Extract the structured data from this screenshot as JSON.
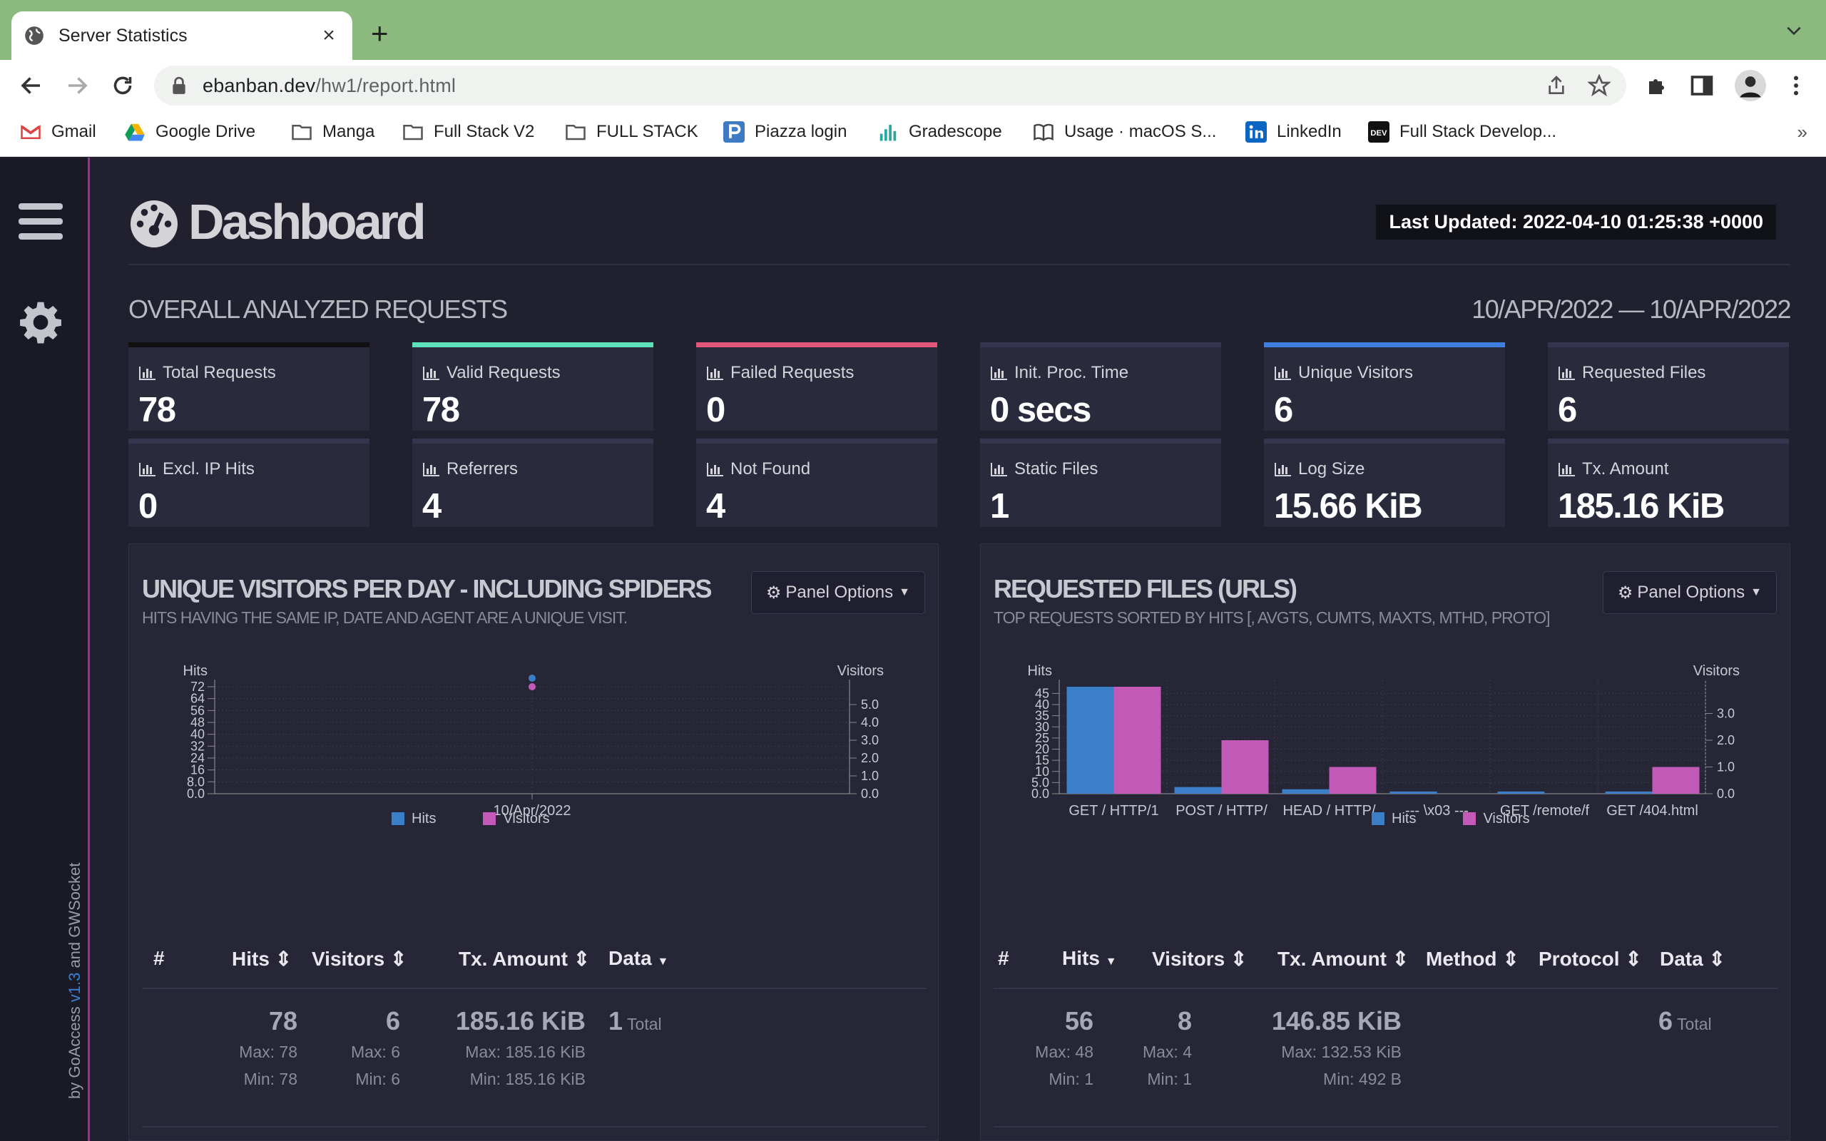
{
  "browser": {
    "tab_title": "Server Statistics",
    "url_domain": "ebanban.dev",
    "url_path": "/hw1/report.html",
    "bookmarks": [
      "Gmail",
      "Google Drive",
      "Manga",
      "Full Stack V2",
      "FULL STACK",
      "Piazza login",
      "Gradescope",
      "Usage · macOS S...",
      "LinkedIn",
      "Full Stack Develop..."
    ],
    "bookmarks_more": "»"
  },
  "sidebar": {
    "credit_by": "by ",
    "credit_goaccess": "GoAccess ",
    "credit_version": "v1.3",
    "credit_and": " and GWSocket"
  },
  "header": {
    "title": "Dashboard",
    "last_updated": "Last Updated: 2022-04-10 01:25:38 +0000"
  },
  "overview": {
    "title": "OVERALL ANALYZED REQUESTS",
    "date_range": "10/APR/2022 — 10/APR/2022",
    "cards": [
      {
        "label": "Total Requests",
        "value": "78",
        "accent": "#111111"
      },
      {
        "label": "Valid Requests",
        "value": "78",
        "accent": "#5ee0b8"
      },
      {
        "label": "Failed Requests",
        "value": "0",
        "accent": "#e0577a"
      },
      {
        "label": "Init. Proc. Time",
        "value": "0 secs",
        "accent": "#353550"
      },
      {
        "label": "Unique Visitors",
        "value": "6",
        "accent": "#3f7fe0"
      },
      {
        "label": "Requested Files",
        "value": "6",
        "accent": "#353550"
      },
      {
        "label": "Excl. IP Hits",
        "value": "0",
        "accent": "#353550"
      },
      {
        "label": "Referrers",
        "value": "4",
        "accent": "#353550"
      },
      {
        "label": "Not Found",
        "value": "4",
        "accent": "#353550"
      },
      {
        "label": "Static Files",
        "value": "1",
        "accent": "#353550"
      },
      {
        "label": "Log Size",
        "value": "15.66 KiB",
        "accent": "#353550"
      },
      {
        "label": "Tx. Amount",
        "value": "185.16 KiB",
        "accent": "#353550"
      }
    ]
  },
  "panels": [
    {
      "title": "UNIQUE VISITORS PER DAY - INCLUDING SPIDERS",
      "subtitle": "HITS HAVING THE SAME IP, DATE AND AGENT ARE A UNIQUE VISIT.",
      "options_label": "Panel Options",
      "legend": [
        "Hits",
        "Visitors"
      ],
      "columns": [
        "#",
        "Hits",
        "Visitors",
        "Tx. Amount",
        "Data"
      ],
      "summary": {
        "hits": "78",
        "hits_max": "Max: 78",
        "hits_min": "Min: 78",
        "visitors": "6",
        "visitors_max": "Max: 6",
        "visitors_min": "Min: 6",
        "tx": "185.16 KiB",
        "tx_max": "Max: 185.16 KiB",
        "tx_min": "Min: 185.16 KiB",
        "data": "1",
        "data_total": "Total"
      }
    },
    {
      "title": "REQUESTED FILES (URLS)",
      "subtitle": "TOP REQUESTS SORTED BY HITS [, AVGTS, CUMTS, MAXTS, MTHD, PROTO]",
      "options_label": "Panel Options",
      "legend": [
        "Hits",
        "Visitors"
      ],
      "columns": [
        "#",
        "Hits",
        "Visitors",
        "Tx. Amount",
        "Method",
        "Protocol",
        "Data"
      ],
      "summary": {
        "hits": "56",
        "hits_max": "Max: 48",
        "hits_min": "Min: 1",
        "visitors": "8",
        "visitors_max": "Max: 4",
        "visitors_min": "Min: 1",
        "tx": "146.85 KiB",
        "tx_max": "Max: 132.53 KiB",
        "tx_min": "Min: 492 B",
        "data": "6",
        "data_total": "Total"
      }
    }
  ],
  "chart_data": [
    {
      "type": "line",
      "x": [
        "10/Apr/2022"
      ],
      "ylabel": "Hits",
      "y2label": "Visitors",
      "y_ticks": [
        "0.0",
        "8.0",
        "16",
        "24",
        "32",
        "40",
        "48",
        "56",
        "64",
        "72"
      ],
      "y2_ticks": [
        "0.0",
        "1.0",
        "2.0",
        "3.0",
        "4.0",
        "5.0"
      ],
      "ylim": [
        0,
        72
      ],
      "y2lim": [
        0,
        6
      ],
      "series": [
        {
          "name": "Hits",
          "values": [
            78
          ],
          "color": "#3a7fc8"
        },
        {
          "name": "Visitors",
          "values": [
            6
          ],
          "color": "#c45ab8"
        }
      ],
      "grid": true,
      "legend_position": "bottom"
    },
    {
      "type": "bar",
      "categories": [
        "GET / HTTP/1",
        "POST / HTTP/",
        "HEAD / HTTP/",
        "--- \\x03 ---",
        "GET /remote/f",
        "GET /404.html"
      ],
      "ylabel": "Hits",
      "y2label": "Visitors",
      "y_ticks": [
        "0.0",
        "5.0",
        "10",
        "15",
        "20",
        "25",
        "30",
        "35",
        "40",
        "45"
      ],
      "y2_ticks": [
        "0.0",
        "1.0",
        "2.0",
        "3.0"
      ],
      "ylim": [
        0,
        48
      ],
      "y2lim": [
        0,
        4
      ],
      "series": [
        {
          "name": "Hits",
          "values": [
            48,
            3,
            2,
            1,
            1,
            1
          ],
          "color": "#3a7fc8"
        },
        {
          "name": "Visitors",
          "values": [
            4,
            2,
            1,
            0,
            0,
            1
          ],
          "color": "#c45ab8"
        }
      ],
      "grid": true,
      "legend_position": "bottom"
    }
  ]
}
